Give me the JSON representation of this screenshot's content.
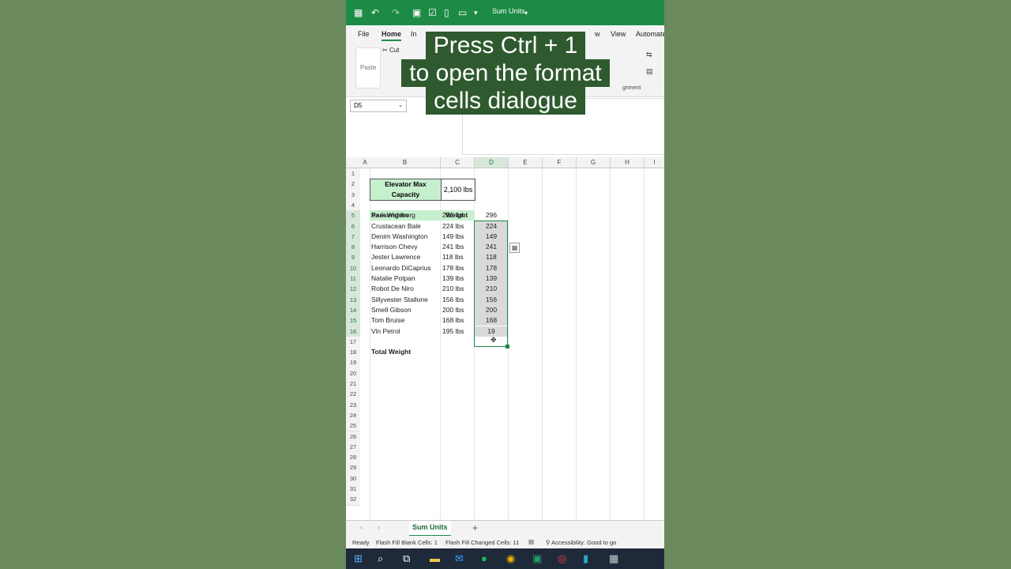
{
  "window": {
    "title": "Sum Units"
  },
  "menu": [
    "File",
    "Home",
    "In",
    "w",
    "View",
    "Automate"
  ],
  "ribbon": {
    "paste": "Paste",
    "cut": "Cut",
    "alignment": "gnment"
  },
  "name_box": "D5",
  "callout": {
    "line1": "Press Ctrl + 1",
    "line2": "to open the format",
    "line3": "cells dialogue"
  },
  "columns": [
    "A",
    "B",
    "C",
    "D",
    "E",
    "F",
    "G",
    "H",
    "I"
  ],
  "row_numbers": [
    "1",
    "2",
    "3",
    "4",
    "5",
    "6",
    "7",
    "8",
    "9",
    "10",
    "11",
    "12",
    "13",
    "14",
    "15",
    "16",
    "17",
    "18",
    "19",
    "20",
    "21",
    "22",
    "23",
    "24",
    "25",
    "26",
    "27",
    "28",
    "29",
    "30",
    "31",
    "32"
  ],
  "capacity": {
    "label_line1": "Elevator Max",
    "label_line2": "Capacity",
    "value": "2,100 lbs"
  },
  "table": {
    "header": {
      "passengers": "Passengers",
      "weight": "Weight"
    },
    "rows": [
      {
        "name": "Bark Wahlberg",
        "weight": "296 lbs",
        "value": "296"
      },
      {
        "name": "Crustacean Bale",
        "weight": "224 lbs",
        "value": "224"
      },
      {
        "name": "Denim Washington",
        "weight": "149 lbs",
        "value": "149"
      },
      {
        "name": "Harrison Chevy",
        "weight": "241 lbs",
        "value": "241"
      },
      {
        "name": "Jester Lawrence",
        "weight": "118 lbs",
        "value": "118"
      },
      {
        "name": "Leonardo DiCaprius",
        "weight": "178 lbs",
        "value": "178"
      },
      {
        "name": "Natalie Potpan",
        "weight": "139 lbs",
        "value": "139"
      },
      {
        "name": "Robot De Niro",
        "weight": "210 lbs",
        "value": "210"
      },
      {
        "name": "Sillyvester Stallone",
        "weight": "156 lbs",
        "value": "156"
      },
      {
        "name": "Smell Gibson",
        "weight": "200 lbs",
        "value": "200"
      },
      {
        "name": "Tom Bruise",
        "weight": "168 lbs",
        "value": "168"
      },
      {
        "name": "Vin Petrol",
        "weight": "195 lbs",
        "value": "19"
      }
    ],
    "total_label": "Total Weight"
  },
  "sheet_tab": "Sum Units",
  "status": {
    "ready": "Ready",
    "blank": "Flash Fill Blank Cells: 1",
    "changed": "Flash Fill Changed Cells: 11",
    "accessibility": "Accessibility: Good to go"
  },
  "colors": {
    "excel_green": "#1d8b45",
    "header_fill": "#c6efce",
    "selection": "#d9d9d9",
    "callout_bg": "#2f5a2f"
  }
}
